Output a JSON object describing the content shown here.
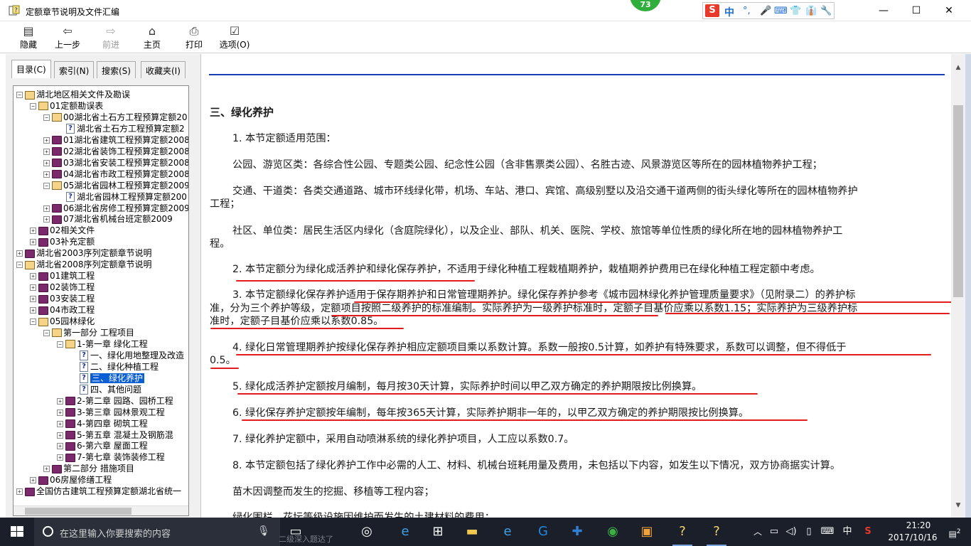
{
  "window": {
    "title": "定额章节说明及文件汇编",
    "badge": "73",
    "minimize": "—",
    "maximize": "☐",
    "close": "✕"
  },
  "ime": {
    "logo": "S",
    "lang": "中",
    "icons": [
      "°,",
      "🎤",
      "⌨",
      "👕",
      "👔",
      "🔧"
    ]
  },
  "toolbar": [
    {
      "key": "hide",
      "label": "隐藏",
      "icon": "hide-icon",
      "glyph": "▤",
      "enabled": true
    },
    {
      "key": "back",
      "label": "上一步",
      "icon": "back-arrow-icon",
      "glyph": "⇦",
      "enabled": true
    },
    {
      "key": "forward",
      "label": "前进",
      "icon": "forward-arrow-icon",
      "glyph": "⇨",
      "enabled": false
    },
    {
      "key": "home",
      "label": "主页",
      "icon": "home-icon",
      "glyph": "⌂",
      "enabled": true
    },
    {
      "key": "print",
      "label": "打印",
      "icon": "print-icon",
      "glyph": "⎙",
      "enabled": true
    },
    {
      "key": "options",
      "label": "选项(O)",
      "icon": "options-icon",
      "glyph": "☑",
      "enabled": true
    }
  ],
  "tabs": [
    {
      "label": "目录(C)",
      "active": true
    },
    {
      "label": "索引(N)",
      "active": false
    },
    {
      "label": "搜索(S)",
      "active": false
    },
    {
      "label": "收藏夹(I)",
      "active": false
    }
  ],
  "tree": [
    {
      "level": 0,
      "exp": "−",
      "icon": "open",
      "text": "湖北地区相关文件及勘误"
    },
    {
      "level": 1,
      "exp": "−",
      "icon": "open",
      "text": "01定额勘误表"
    },
    {
      "level": 2,
      "exp": "−",
      "icon": "open",
      "text": "00湖北省土石方工程预算定额20"
    },
    {
      "level": 3,
      "exp": "",
      "icon": "doc",
      "text": "湖北省土石方工程预算定额2"
    },
    {
      "level": 2,
      "exp": "+",
      "icon": "closed",
      "text": "01湖北省建筑工程预算定额2008"
    },
    {
      "level": 2,
      "exp": "+",
      "icon": "closed",
      "text": "02湖北省装饰工程预算定额2008"
    },
    {
      "level": 2,
      "exp": "+",
      "icon": "closed",
      "text": "03湖北省安装工程预算定额2008"
    },
    {
      "level": 2,
      "exp": "+",
      "icon": "closed",
      "text": "04湖北省市政工程预算定额2008"
    },
    {
      "level": 2,
      "exp": "−",
      "icon": "open",
      "text": "05湖北省园林工程预算定额2009"
    },
    {
      "level": 3,
      "exp": "",
      "icon": "doc",
      "text": "湖北省园林工程预算定额200"
    },
    {
      "level": 2,
      "exp": "+",
      "icon": "closed",
      "text": "06湖北省房修工程预算定额2009"
    },
    {
      "level": 2,
      "exp": "+",
      "icon": "closed",
      "text": "07湖北省机械台班定额2009"
    },
    {
      "level": 1,
      "exp": "+",
      "icon": "closed",
      "text": "02相关文件"
    },
    {
      "level": 1,
      "exp": "+",
      "icon": "closed",
      "text": "03补充定额"
    },
    {
      "level": 0,
      "exp": "+",
      "icon": "closed",
      "text": "湖北省2003序列定额章节说明"
    },
    {
      "level": 0,
      "exp": "−",
      "icon": "open",
      "text": "湖北省2008序列定额章节说明"
    },
    {
      "level": 1,
      "exp": "+",
      "icon": "closed",
      "text": "01建筑工程"
    },
    {
      "level": 1,
      "exp": "+",
      "icon": "closed",
      "text": "02装饰工程"
    },
    {
      "level": 1,
      "exp": "+",
      "icon": "closed",
      "text": "03安装工程"
    },
    {
      "level": 1,
      "exp": "+",
      "icon": "closed",
      "text": "04市政工程"
    },
    {
      "level": 1,
      "exp": "−",
      "icon": "open",
      "text": "05园林绿化"
    },
    {
      "level": 2,
      "exp": "−",
      "icon": "open",
      "text": "第一部分  工程项目"
    },
    {
      "level": 3,
      "exp": "−",
      "icon": "open",
      "text": "1-第一章  绿化工程"
    },
    {
      "level": 4,
      "exp": "",
      "icon": "doc",
      "text": "一、绿化用地整理及改造"
    },
    {
      "level": 4,
      "exp": "",
      "icon": "doc",
      "text": "二、绿化种植工程"
    },
    {
      "level": 4,
      "exp": "",
      "icon": "doc",
      "text": "三、绿化养护",
      "selected": true
    },
    {
      "level": 4,
      "exp": "",
      "icon": "doc",
      "text": "四、其他问题"
    },
    {
      "level": 3,
      "exp": "+",
      "icon": "closed",
      "text": "2-第二章  园路、园桥工程"
    },
    {
      "level": 3,
      "exp": "+",
      "icon": "closed",
      "text": "3-第三章   园林景观工程"
    },
    {
      "level": 3,
      "exp": "+",
      "icon": "closed",
      "text": "4-第四章   砌筑工程"
    },
    {
      "level": 3,
      "exp": "+",
      "icon": "closed",
      "text": "5-第五章   混凝土及钢筋混"
    },
    {
      "level": 3,
      "exp": "+",
      "icon": "closed",
      "text": "6-第六章   屋面工程"
    },
    {
      "level": 3,
      "exp": "+",
      "icon": "closed",
      "text": "7-第七章   装饰装修工程"
    },
    {
      "level": 2,
      "exp": "+",
      "icon": "closed",
      "text": "第二部分  措施项目"
    },
    {
      "level": 1,
      "exp": "+",
      "icon": "closed",
      "text": "06房屋修缮工程"
    },
    {
      "level": 0,
      "exp": "+",
      "icon": "closed",
      "text": "全国仿古建筑工程预算定额湖北省统一"
    }
  ],
  "content": {
    "heading": "三、绿化养护",
    "p1": "1. 本节定额适用范围：",
    "p1a": "公园、游览区类：各综合性公园、专题类公园、纪念性公园（含非售票类公园）、名胜古迹、风景游览区等所在的园林植物养护工程；",
    "p1b_1": "交通、干道类：各类交通道路、城市环线绿化带，机场、车站、港口、宾馆、高级别墅以及沿交通干道两侧的街头绿化等所在的园林植物养护",
    "p1b_2": "工程；",
    "p1c_1": "社区、单位类：居民生活区内绿化（含庭院绿化），以及企业、部队、机关、医院、学校、旅馆等单位性质的绿化所在地的园林植物养护工",
    "p1c_2": "程。",
    "p2": "2. 本节定额分为绿化成活养护和绿化保存养护，不适用于绿化种植工程栽植期养护，栽植期养护费用已在绿化种植工程定额中考虑。",
    "p3_1": "3. 本节定额绿化保存养护适用于保存期养护和日常管理期养护。绿化保存养护参考《城市园林绿化养护管理质量要求》（见附录二）的养护标",
    "p3_2": "准，分为三个养护等级，定额项目按照二级养护的标准编制。实际养护为一级养护标准时，定额子目基价应乘以系数1.15；实际养护为三级养护标",
    "p3_3": "准时，定额子目基价应乘以系数0.85。",
    "p4_1": "4. 绿化日常管理期养护按绿化保存养护相应定额项目乘以系数计算。系数一般按0.5计算，如养护有特殊要求，系数可以调整，但不得低于",
    "p4_2": "0.5。",
    "p5": "5. 绿化成活养护定额按月编制，每月按30天计算，实际养护时间以甲乙双方确定的养护期限按比例换算。",
    "p6": "6. 绿化保存养护定额按年编制，每年按365天计算，实际养护期非一年的，以甲乙双方确定的养护期限按比例换算。",
    "p7": "7. 绿化养护定额中，采用自动喷淋系统的绿化养护项目，人工应以系数0.7。",
    "p8": "8. 本节定额包括了绿化养护工作中必需的人工、材料、机械台班耗用量及费用，未包括以下内容，如发生以下情况，双方协商据实计算。",
    "p9": "苗木因调整而发生的挖掘、移植等工程内容；",
    "p10": "绿化围栏、花坛等级设施因维护而发生的土建材料的费用；"
  },
  "taskbar": {
    "search_placeholder": "在这里输入你要搜索的内容",
    "ghost_text": "二级深入题达了",
    "time": "21:20",
    "date": "2017/10/16",
    "ime_lang": "中",
    "notification_count": "2",
    "apps": [
      "task-view-icon",
      "cortana-app-icon",
      "edge-icon",
      "store-icon",
      "file-explorer-icon",
      "ie-icon",
      "sogou-browser-icon",
      "remote-icon",
      "360-icon",
      "notes-icon",
      "chm-help-icon",
      "chm-help-icon-2"
    ]
  }
}
